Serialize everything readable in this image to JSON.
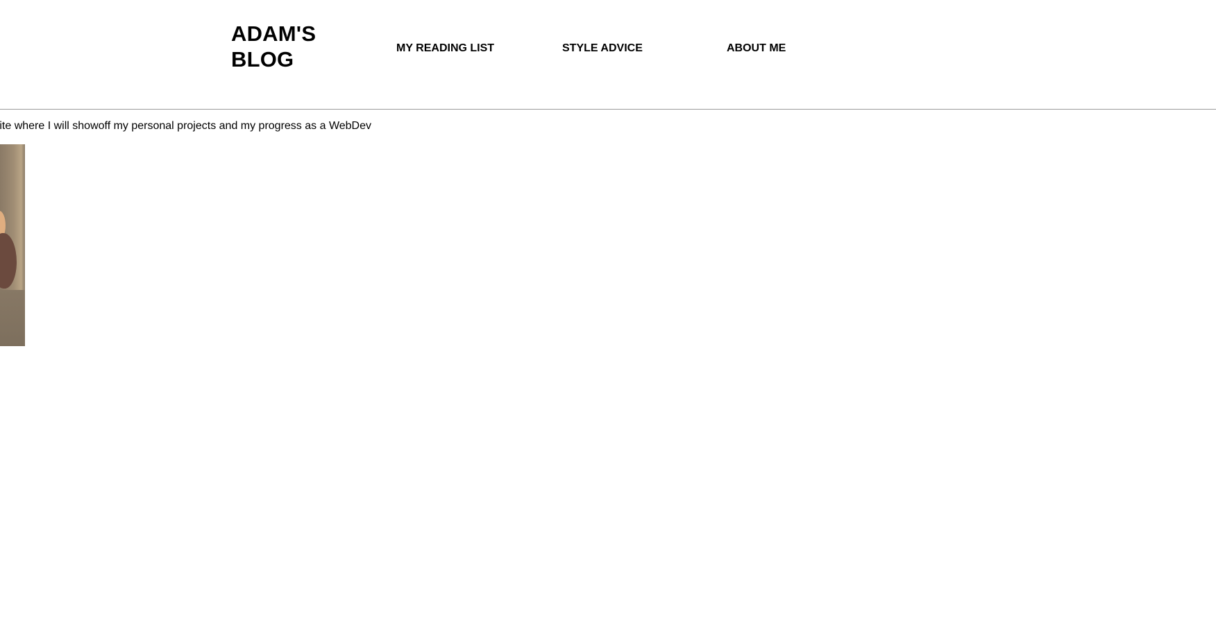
{
  "header": {
    "site_title": "ADAM'S BLOG",
    "nav": [
      {
        "label": "MY READING LIST"
      },
      {
        "label": "STYLE ADVICE"
      },
      {
        "label": "ABOUT ME"
      }
    ]
  },
  "main": {
    "intro_text": "ite where I will showoff my personal projects and my progress as a WebDev"
  },
  "colors": {
    "text": "#000000",
    "background": "#ffffff",
    "divider": "#9a9a9a"
  }
}
